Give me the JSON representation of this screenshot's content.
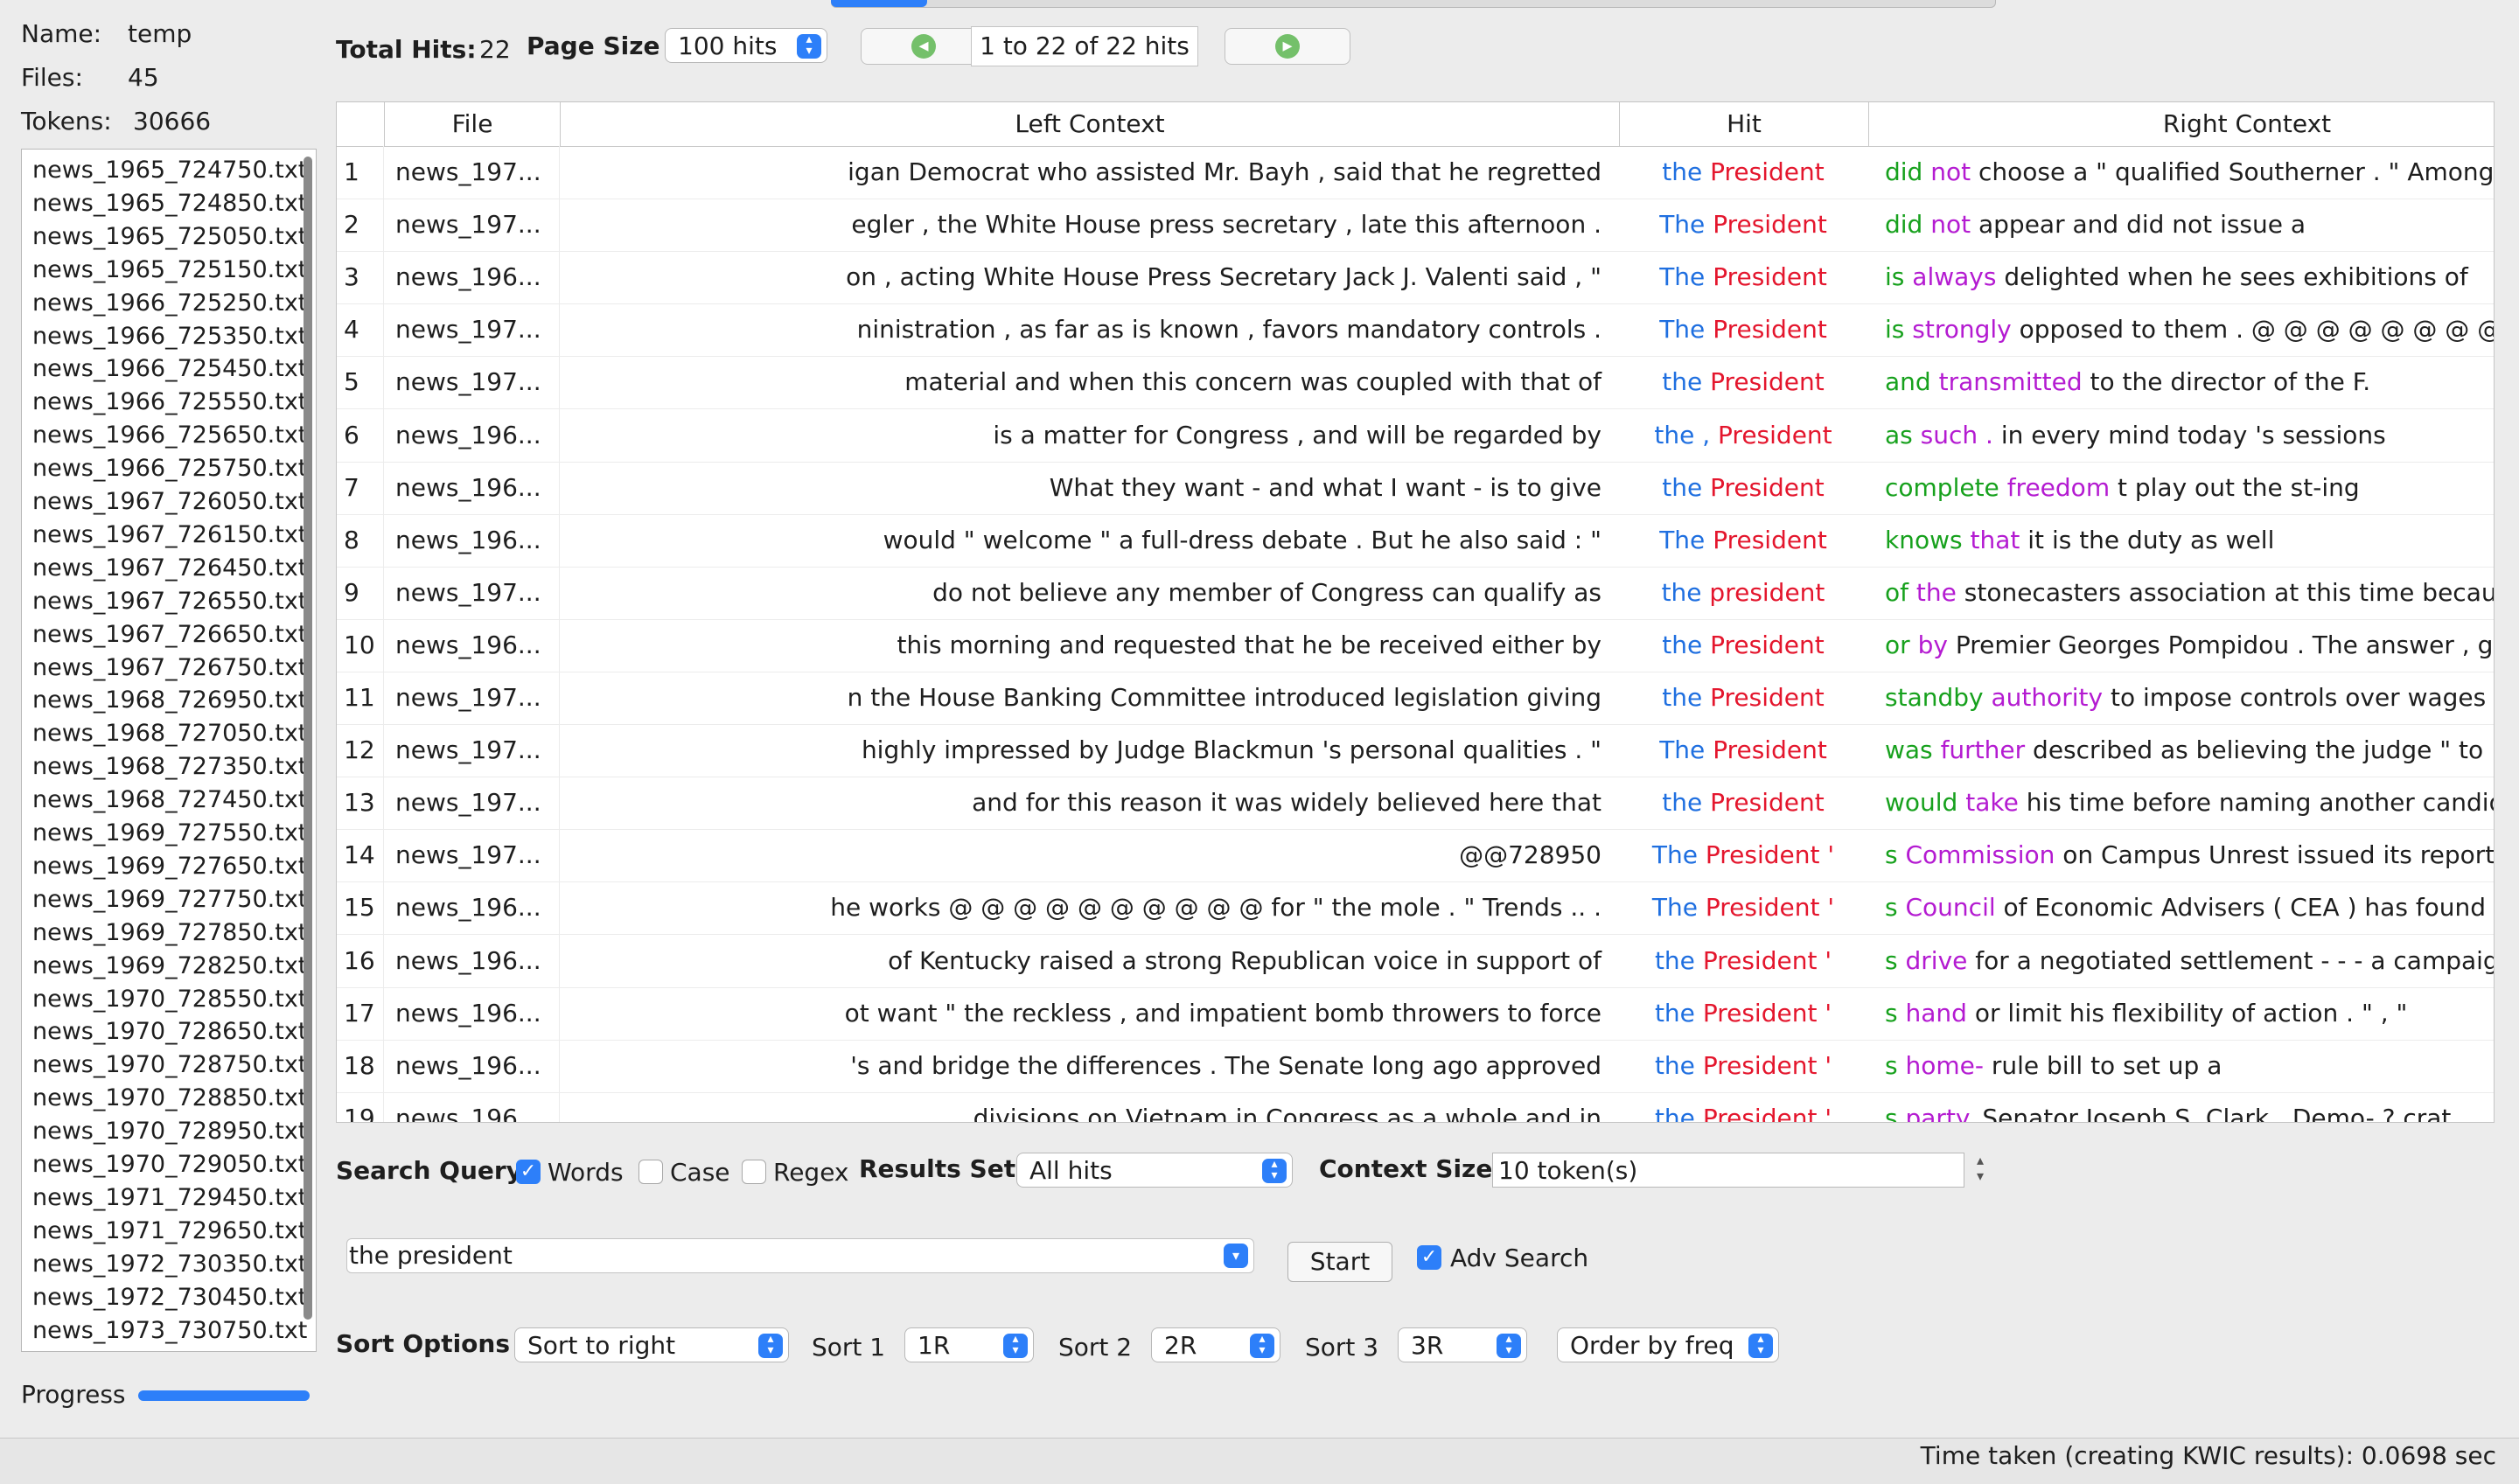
{
  "corpus": {
    "name_label": "Name:",
    "name_value": "temp",
    "files_label": "Files:",
    "files_value": "45",
    "tokens_label": "Tokens:",
    "tokens_value": "30666"
  },
  "files": [
    "news_1965_724750.txt",
    "news_1965_724850.txt",
    "news_1965_725050.txt",
    "news_1965_725150.txt",
    "news_1966_725250.txt",
    "news_1966_725350.txt",
    "news_1966_725450.txt",
    "news_1966_725550.txt",
    "news_1966_725650.txt",
    "news_1966_725750.txt",
    "news_1967_726050.txt",
    "news_1967_726150.txt",
    "news_1967_726450.txt",
    "news_1967_726550.txt",
    "news_1967_726650.txt",
    "news_1967_726750.txt",
    "news_1968_726950.txt",
    "news_1968_727050.txt",
    "news_1968_727350.txt",
    "news_1968_727450.txt",
    "news_1969_727550.txt",
    "news_1969_727650.txt",
    "news_1969_727750.txt",
    "news_1969_727850.txt",
    "news_1969_728250.txt",
    "news_1970_728550.txt",
    "news_1970_728650.txt",
    "news_1970_728750.txt",
    "news_1970_728850.txt",
    "news_1970_728950.txt",
    "news_1970_729050.txt",
    "news_1971_729450.txt",
    "news_1971_729650.txt",
    "news_1972_730350.txt",
    "news_1972_730450.txt",
    "news_1973_730750.txt"
  ],
  "progress_label": "Progress",
  "progress_value": 1.0,
  "header": {
    "total_hits_label": "Total Hits:",
    "total_hits_value": "22",
    "page_size_label": "Page Size",
    "page_size_value": "100 hits",
    "page_range": "1 to 22 of 22 hits"
  },
  "table": {
    "columns": [
      "File",
      "Left Context",
      "Hit",
      "Right Context"
    ],
    "rows": [
      {
        "n": "1",
        "file": "news_197...",
        "left": "igan Democrat who assisted Mr. Bayh , said that he regretted",
        "hit1": "the",
        "hit2": "President",
        "r1": "did",
        "r2": "not",
        "r3": "choose a \" qualified Southerner . \" Among influential"
      },
      {
        "n": "2",
        "file": "news_197...",
        "left": "egler , the White House press secretary , late this afternoon .",
        "hit1": "The",
        "hit2": "President",
        "r1": "did",
        "r2": "not",
        "r3": "appear and did not issue a"
      },
      {
        "n": "3",
        "file": "news_196...",
        "left": "on , acting White House Press Secretary Jack J. Valenti said , \"",
        "hit1": "The",
        "hit2": "President",
        "r1": "is",
        "r2": "always",
        "r3": "delighted when he sees exhibitions of"
      },
      {
        "n": "4",
        "file": "news_197...",
        "left": "ninistration , as far as is known , favors mandatory controls .",
        "hit1": "The",
        "hit2": "President",
        "r1": "is",
        "r2": "strongly",
        "r3": "opposed to them . @ @ @ @ @ @ @ @ @ @ dinner"
      },
      {
        "n": "5",
        "file": "news_197...",
        "left": "material and when this concern was coupled with that of",
        "hit1": "the",
        "hit2": "President",
        "r1": "and",
        "r2": "transmitted",
        "r3": "to the director of the F."
      },
      {
        "n": "6",
        "file": "news_196...",
        "left": "is a matter for Congress , and will be regarded by",
        "hit1": "the ,",
        "hit2": "President",
        "r1": "as",
        "r2": "such .",
        "r3": "in every mind today 's sessions"
      },
      {
        "n": "7",
        "file": "news_196...",
        "left": "What they want - and what I want - is to give",
        "hit1": "the",
        "hit2": "President",
        "r1": "complete",
        "r2": "freedom",
        "r3": "t play out the st-ing"
      },
      {
        "n": "8",
        "file": "news_196...",
        "left": "would \" welcome \" a full-dress debate . But he also said : \"",
        "hit1": "The",
        "hit2": "President",
        "r1": "knows",
        "r2": "that",
        "r3": "it is the duty as well"
      },
      {
        "n": "9",
        "file": "news_197...",
        "left": "do not believe any member of Congress can qualify as",
        "hit1": "the",
        "hit2": "president",
        "r1": "of",
        "r2": "the",
        "r3": "stonecasters association at this time because"
      },
      {
        "n": "10",
        "file": "news_196...",
        "left": "this morning and requested that he be received either by",
        "hit1": "the",
        "hit2": "President",
        "r1": "or",
        "r2": "by",
        "r3": "Premier Georges Pompidou . The answer , given"
      },
      {
        "n": "11",
        "file": "news_197...",
        "left": "n the House Banking Committee introduced legislation giving",
        "hit1": "the",
        "hit2": "President",
        "r1": "standby",
        "r2": "authority",
        "r3": "to impose controls over wages , prices"
      },
      {
        "n": "12",
        "file": "news_197...",
        "left": "highly impressed by Judge Blackmun 's personal qualities . \"",
        "hit1": "The",
        "hit2": "President",
        "r1": "was",
        "r2": "further",
        "r3": "described as believing the judge \" to"
      },
      {
        "n": "13",
        "file": "news_197...",
        "left": "and for this reason it was widely believed here that",
        "hit1": "the",
        "hit2": "President",
        "r1": "would",
        "r2": "take",
        "r3": "his time before naming another candidate"
      },
      {
        "n": "14",
        "file": "news_197...",
        "left": "@@728950",
        "hit1": "The",
        "hit2": "President '",
        "r1": "s",
        "r2": "Commission",
        "r3": "on Campus Unrest issued its report"
      },
      {
        "n": "15",
        "file": "news_196...",
        "left": "he works @ @ @ @ @ @ @ @ @ @ for \" the mole . \" Trends .. .",
        "hit1": "The",
        "hit2": "President '",
        "r1": "s",
        "r2": "Council",
        "r3": "of Economic Advisers ( CEA ) has found"
      },
      {
        "n": "16",
        "file": "news_196...",
        "left": "of Kentucky raised a strong Republican voice in support of",
        "hit1": "the",
        "hit2": "President '",
        "r1": "s",
        "r2": "drive",
        "r3": "for a negotiated settlement - - - a campaign"
      },
      {
        "n": "17",
        "file": "news_196...",
        "left": "ot want \" the reckless , and impatient bomb throwers to force",
        "hit1": "the",
        "hit2": "President '",
        "r1": "s",
        "r2": "hand",
        "r3": "or limit his flexibility of action . \" , \""
      },
      {
        "n": "18",
        "file": "news_196...",
        "left": "'s and bridge the differences . The Senate long ago approved",
        "hit1": "the",
        "hit2": "President '",
        "r1": "s",
        "r2": "home-",
        "r3": "rule bill to set up a"
      },
      {
        "n": "19",
        "file": "news_196...",
        "left": "divisions on Vietnam in Congress as a whole and in",
        "hit1": "the",
        "hit2": "President '",
        "r1": "s",
        "r2": "party.",
        "r3": "Senator Joseph S. Clark , Demo- ? crat"
      }
    ]
  },
  "search": {
    "query_label": "Search Query",
    "words_label": "Words",
    "words_checked": true,
    "case_label": "Case",
    "case_checked": false,
    "regex_label": "Regex",
    "regex_checked": false,
    "results_set_label": "Results Set",
    "results_set_value": "All hits",
    "context_size_label": "Context Size",
    "context_size_value": "10 token(s)",
    "query_value": "the president",
    "start_label": "Start",
    "adv_search_label": "Adv Search",
    "adv_search_checked": true
  },
  "sort": {
    "options_label": "Sort Options",
    "mode_value": "Sort to right",
    "sort1_label": "Sort 1",
    "sort1_value": "1R",
    "sort2_label": "Sort 2",
    "sort2_value": "2R",
    "sort3_label": "Sort 3",
    "sort3_value": "3R",
    "order_value": "Order by freq"
  },
  "status": {
    "text": "Time taken (creating KWIC results):  0.0698 sec"
  },
  "colors": {
    "accent": "#2d7ff9",
    "hit_article": "#1f6fe0",
    "hit_node": "#e4162d",
    "right_1": "#17a11d",
    "right_2": "#b41bd1"
  }
}
